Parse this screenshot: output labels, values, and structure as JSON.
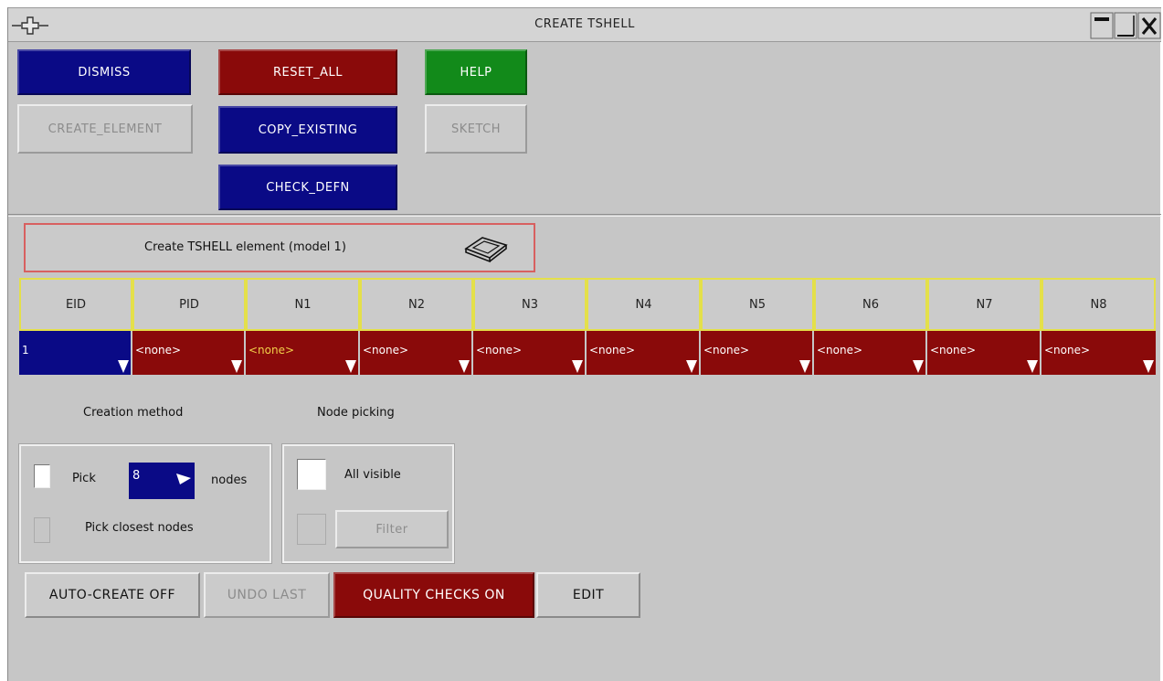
{
  "window": {
    "title": "CREATE TSHELL"
  },
  "icons": {
    "move": "move-icon",
    "minimize": "minimize-icon",
    "restore": "restore-icon",
    "close": "close-icon",
    "tshell": "tshell-element-icon",
    "dropdown": "dropdown-corner-icon"
  },
  "toolbar": {
    "dismiss": "DISMISS",
    "reset_all": "RESET_ALL",
    "help": "HELP",
    "create_element": "CREATE_ELEMENT",
    "copy_existing": "COPY_EXISTING",
    "sketch": "SKETCH",
    "check_defn": "CHECK_DEFN"
  },
  "create_panel": {
    "label": "Create TSHELL element (model 1)"
  },
  "table": {
    "headers": [
      "EID",
      "PID",
      "N1",
      "N2",
      "N3",
      "N4",
      "N5",
      "N6",
      "N7",
      "N8"
    ],
    "values": [
      "1",
      "<none>",
      "<none>",
      "<none>",
      "<none>",
      "<none>",
      "<none>",
      "<none>",
      "<none>",
      "<none>"
    ]
  },
  "creation_method": {
    "heading": "Creation method",
    "pick_label": "Pick",
    "pick_count": "8",
    "nodes_label": "nodes",
    "closest_label": "Pick closest nodes"
  },
  "node_picking": {
    "heading": "Node picking",
    "all_visible_label": "All visible",
    "filter_label": "Filter"
  },
  "bottom_bar": {
    "auto_create": "AUTO-CREATE OFF",
    "undo_last": "UNDO LAST",
    "quality_checks": "QUALITY CHECKS ON",
    "edit": "EDIT"
  },
  "colors": {
    "blue": "#0a0a86",
    "red": "#8a0a0a",
    "green": "#128a1a",
    "panel": "#c6c6c6",
    "header_border": "#e4e04a"
  }
}
